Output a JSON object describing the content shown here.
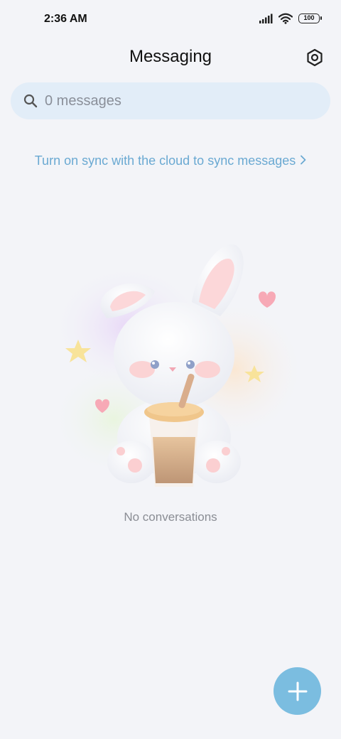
{
  "status_bar": {
    "time": "2:36 AM",
    "battery_level": "100",
    "icons": [
      "signal-icon",
      "wifi-icon",
      "battery-icon"
    ]
  },
  "header": {
    "title": "Messaging",
    "settings_icon": "gear-icon"
  },
  "search": {
    "placeholder": "0 messages",
    "value": ""
  },
  "sync_banner": {
    "label": "Turn on sync with the cloud to sync messages"
  },
  "empty_state": {
    "illustration": "bunny-with-drink-illustration",
    "message": "No conversations"
  },
  "fab": {
    "icon": "plus-icon",
    "color": "#7bbde0"
  },
  "colors": {
    "background": "#f3f4f8",
    "search_bg": "#e2edf8",
    "link": "#6aa9d2",
    "muted_text": "#8a8d94"
  }
}
